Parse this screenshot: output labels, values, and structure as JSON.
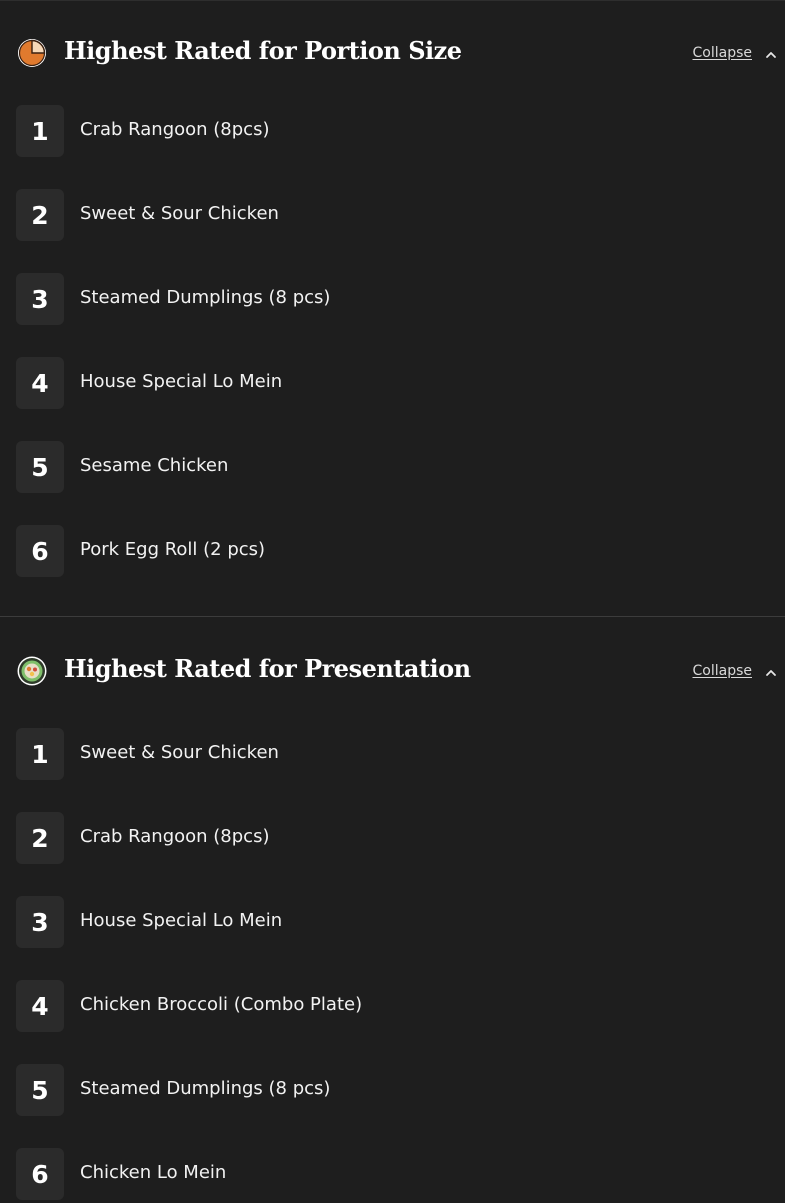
{
  "sections": [
    {
      "title": "Highest Rated for Portion Size",
      "icon": "pie-chart-icon",
      "collapse_label": "Collapse",
      "items": [
        {
          "rank": "1",
          "label": "Crab Rangoon (8pcs)"
        },
        {
          "rank": "2",
          "label": "Sweet & Sour Chicken"
        },
        {
          "rank": "3",
          "label": "Steamed Dumplings (8 pcs)"
        },
        {
          "rank": "4",
          "label": "House Special Lo Mein"
        },
        {
          "rank": "5",
          "label": "Sesame Chicken"
        },
        {
          "rank": "6",
          "label": "Pork Egg Roll (2 pcs)"
        }
      ]
    },
    {
      "title": "Highest Rated for Presentation",
      "icon": "plated-dish-icon",
      "collapse_label": "Collapse",
      "items": [
        {
          "rank": "1",
          "label": "Sweet & Sour Chicken"
        },
        {
          "rank": "2",
          "label": "Crab Rangoon (8pcs)"
        },
        {
          "rank": "3",
          "label": "House Special Lo Mein"
        },
        {
          "rank": "4",
          "label": "Chicken Broccoli (Combo Plate)"
        },
        {
          "rank": "5",
          "label": "Steamed Dumplings (8 pcs)"
        },
        {
          "rank": "6",
          "label": "Chicken Lo Mein"
        }
      ]
    }
  ],
  "colors": {
    "background": "#1e1e1e",
    "badge": "#2b2b2b",
    "accent_orange": "#e07a2e",
    "accent_green": "#7fbf6a"
  }
}
